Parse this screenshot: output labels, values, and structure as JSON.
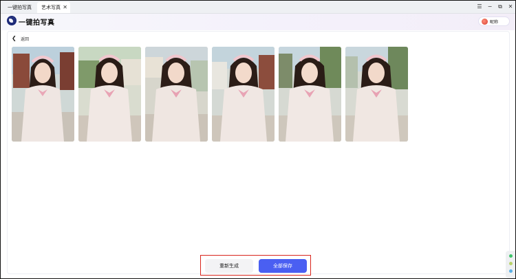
{
  "tabs": [
    {
      "label": "一键拍写真"
    },
    {
      "label": "艺术写真",
      "close": "✕"
    }
  ],
  "window_controls": {
    "menu": "☰",
    "minimize": "−",
    "restore": "⧉",
    "close": "✕"
  },
  "header": {
    "app_title": "一键拍写真",
    "user_name": "昵称"
  },
  "content": {
    "back_label": "返回",
    "photos": [
      {
        "alt": "portrait-1"
      },
      {
        "alt": "portrait-2"
      },
      {
        "alt": "portrait-3"
      },
      {
        "alt": "portrait-4"
      },
      {
        "alt": "portrait-5"
      },
      {
        "alt": "portrait-6"
      }
    ]
  },
  "actions": {
    "regenerate": "重新生成",
    "save_all": "全部保存"
  },
  "colors": {
    "accent": "#4a5ff2",
    "highlight_border": "#d9241b"
  }
}
